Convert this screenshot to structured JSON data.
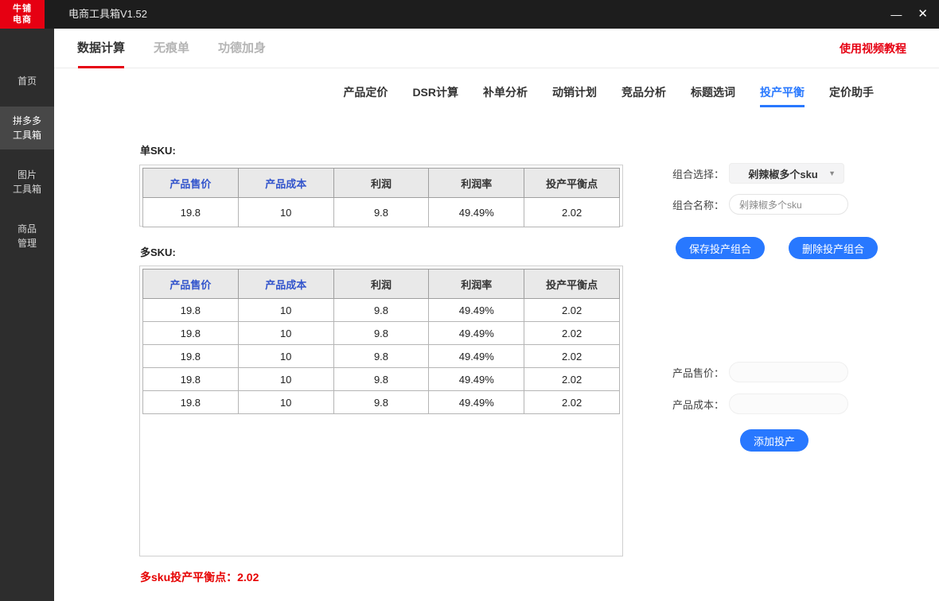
{
  "window": {
    "logo_line1": "牛铺",
    "logo_line2": "电商",
    "title": "电商工具箱V1.52",
    "minimize_glyph": "—",
    "close_glyph": "✕"
  },
  "sidebar": {
    "items": [
      {
        "lines": [
          "首页"
        ],
        "active": false
      },
      {
        "lines": [
          "拼多多",
          "工具箱"
        ],
        "active": true
      },
      {
        "lines": [
          "图片",
          "工具箱"
        ],
        "active": false
      },
      {
        "lines": [
          "商品",
          "管理"
        ],
        "active": false
      }
    ]
  },
  "top_nav": {
    "tabs": [
      {
        "label": "数据计算",
        "active": true
      },
      {
        "label": "无痕单",
        "active": false
      },
      {
        "label": "功德加身",
        "active": false
      }
    ],
    "video_link": "使用视频教程"
  },
  "sub_nav": {
    "tabs": [
      {
        "label": "产品定价",
        "active": false
      },
      {
        "label": "DSR计算",
        "active": false
      },
      {
        "label": "补单分析",
        "active": false
      },
      {
        "label": "动销计划",
        "active": false
      },
      {
        "label": "竞品分析",
        "active": false
      },
      {
        "label": "标题选词",
        "active": false
      },
      {
        "label": "投产平衡",
        "active": true
      },
      {
        "label": "定价助手",
        "active": false
      }
    ]
  },
  "single_sku_table": {
    "label": "单SKU:",
    "headers": [
      "产品售价",
      "产品成本",
      "利润",
      "利润率",
      "投产平衡点"
    ],
    "rows": [
      [
        "19.8",
        "10",
        "9.8",
        "49.49%",
        "2.02"
      ]
    ]
  },
  "multi_sku_table": {
    "label": "多SKU:",
    "headers": [
      "产品售价",
      "产品成本",
      "利润",
      "利润率",
      "投产平衡点"
    ],
    "rows": [
      [
        "19.8",
        "10",
        "9.8",
        "49.49%",
        "2.02"
      ],
      [
        "19.8",
        "10",
        "9.8",
        "49.49%",
        "2.02"
      ],
      [
        "19.8",
        "10",
        "9.8",
        "49.49%",
        "2.02"
      ],
      [
        "19.8",
        "10",
        "9.8",
        "49.49%",
        "2.02"
      ],
      [
        "19.8",
        "10",
        "9.8",
        "49.49%",
        "2.02"
      ]
    ]
  },
  "summary_note": "多sku投产平衡点：2.02",
  "form": {
    "combo_select_label": "组合选择：",
    "combo_select_value": "剁辣椒多个sku",
    "combo_name_label": "组合名称：",
    "combo_name_value": "剁辣椒多个sku",
    "save_button": "保存投产组合",
    "delete_button": "删除投产组合",
    "price_label": "产品售价：",
    "cost_label": "产品成本：",
    "add_button": "添加投产"
  },
  "colors": {
    "accent_red": "#e60012",
    "accent_blue": "#2878ff",
    "header_blue": "#3355cc"
  }
}
